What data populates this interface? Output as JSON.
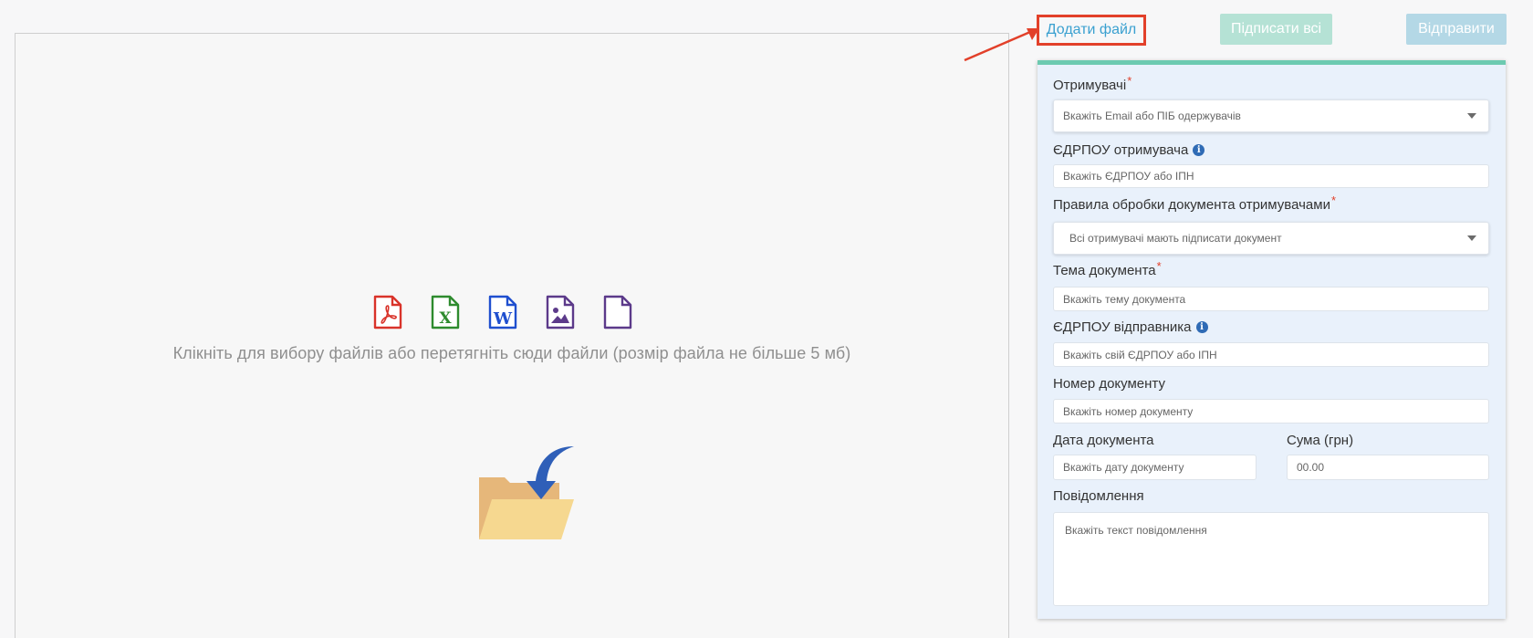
{
  "toolbar": {
    "add_file": "Додати файл",
    "sign_all": "Підписати всі",
    "send": "Відправити"
  },
  "dropzone": {
    "hint": "Клікніть для вибору файлів або перетягніть сюди файли (розмір файла не більше 5 мб)",
    "icons": [
      "pdf-file-icon",
      "excel-file-icon",
      "word-file-icon",
      "image-file-icon",
      "blank-file-icon",
      "folder-download-icon"
    ]
  },
  "form": {
    "recipients": {
      "label": "Отримувачі",
      "required_mark": "*",
      "placeholder": "Вкажіть Email або ПІБ одержувачів"
    },
    "recipient_code": {
      "label": "ЄДРПОУ отримувача",
      "info": "i",
      "placeholder": "Вкажіть ЄДРПОУ або ІПН"
    },
    "processing_rules": {
      "label": "Правила обробки документа отримувачами",
      "required_mark": "*",
      "value": "Всі отримувачі мають підписати документ"
    },
    "subject": {
      "label": "Тема документа",
      "required_mark": "*",
      "placeholder": "Вкажіть тему документа"
    },
    "sender_code": {
      "label": "ЄДРПОУ відправника",
      "info": "i",
      "placeholder": "Вкажіть свій ЄДРПОУ або ІПН"
    },
    "doc_number": {
      "label": "Номер документу",
      "placeholder": "Вкажіть номер документу"
    },
    "doc_date": {
      "label": "Дата документа",
      "placeholder": "Вкажіть дату документу"
    },
    "amount": {
      "label": "Сума (грн)",
      "placeholder": "00.00"
    },
    "message": {
      "label": "Повідомлення",
      "placeholder": "Вкажіть текст повідомлення"
    }
  },
  "colors": {
    "annotation_red": "#e2402a",
    "link_blue": "#3aa0d0",
    "sign_green_disabled": "#b5e2d5",
    "send_blue_disabled": "#b4d8e6",
    "panel_bg": "#e9f1fb",
    "panel_top_border": "#6ccab0"
  }
}
